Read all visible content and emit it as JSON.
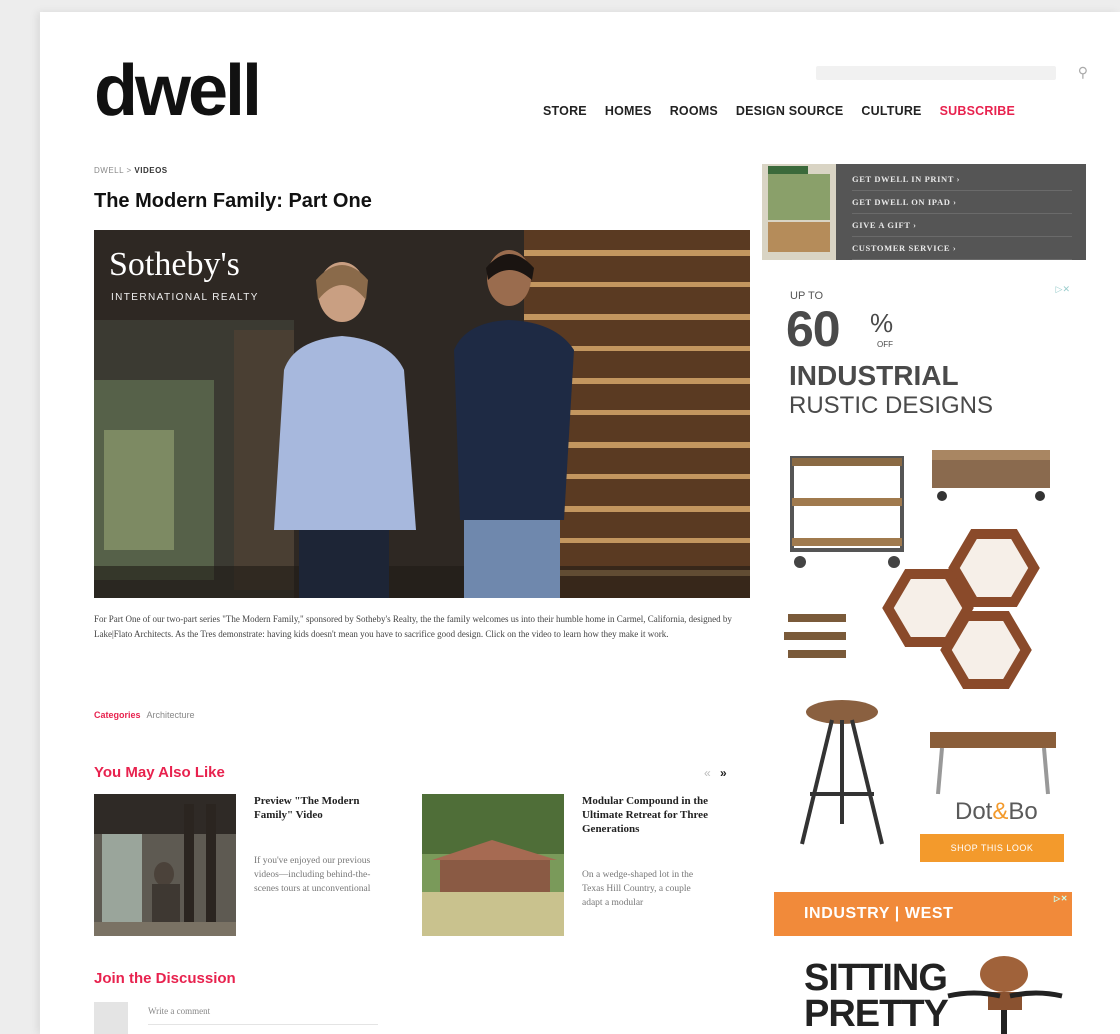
{
  "header": {
    "logo": "dwell",
    "nav": [
      "STORE",
      "HOMES",
      "ROOMS",
      "DESIGN SOURCE",
      "CULTURE"
    ],
    "subscribe": "SUBSCRIBE"
  },
  "breadcrumb": {
    "root": "DWELL >",
    "current": "VIDEOS"
  },
  "article": {
    "title": "The Modern Family: Part One",
    "sponsor_name": "Sotheby's",
    "sponsor_sub": "INTERNATIONAL REALTY",
    "description": "For Part One of our two-part series \"The Modern Family,\" sponsored by Sotheby's Realty, the the family welcomes us into their humble home in Carmel, California, designed by Lake|Flato Architects. As the Tres demonstrate: having kids doesn't mean you have to sacrifice good design. Click on the video to learn how they make it work.",
    "categories_label": "Categories",
    "categories_value": "Architecture"
  },
  "related": {
    "heading": "You May Also Like",
    "prev": "«",
    "next": "»",
    "items": [
      {
        "title": "Preview \"The Modern Family\" Video",
        "snippet": "If you've enjoyed our previous videos—including behind-the-scenes tours at unconventional"
      },
      {
        "title": "Modular Compound in the Ultimate Retreat for Three Generations",
        "snippet": "On a wedge-shaped lot in the Texas Hill Country, a couple adapt a modular"
      }
    ]
  },
  "discussion": {
    "heading": "Join the Discussion",
    "placeholder": "Write a comment"
  },
  "promo": {
    "links": [
      "GET DWELL IN PRINT ›",
      "GET DWELL ON IPAD ›",
      "GIVE A GIFT ›",
      "CUSTOMER SERVICE ›"
    ]
  },
  "ad1": {
    "upto": "UP TO",
    "percent": "60",
    "pct_sign": "%",
    "off": "OFF",
    "line1": "INDUSTRIAL",
    "line2": "RUSTIC DESIGNS",
    "brand_a": "Dot",
    "brand_b": "&",
    "brand_c": "Bo",
    "cta": "SHOP THIS LOOK",
    "adchoices": "▷✕"
  },
  "ad2": {
    "brand": "INDUSTRY | WEST",
    "headline": "SITTING PRETTY",
    "adchoices": "▷✕"
  },
  "colors": {
    "accent": "#e8224e",
    "ad_orange": "#f39a2c"
  },
  "icons": {
    "search": "search-icon"
  }
}
